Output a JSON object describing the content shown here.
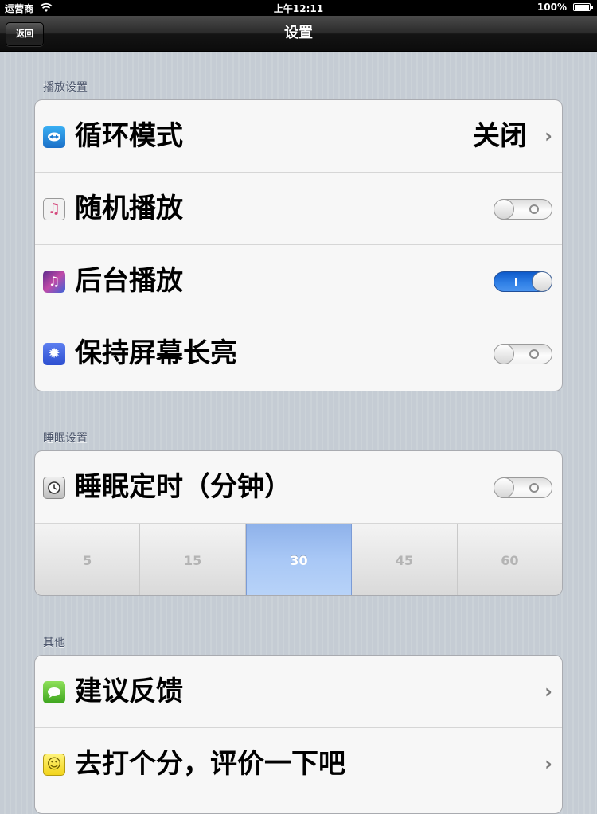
{
  "status_bar": {
    "carrier": "运营商",
    "time": "上午12:11",
    "battery": "100%"
  },
  "nav": {
    "back_label": "返回",
    "title": "设置"
  },
  "playback": {
    "header": "播放设置",
    "loop_mode": {
      "label": "循环模式",
      "value": "关闭",
      "icon": "loop-icon"
    },
    "shuffle": {
      "label": "随机播放",
      "on": false,
      "icon": "shuffle-music-icon"
    },
    "background_play": {
      "label": "后台播放",
      "on": true,
      "icon": "music-note-icon"
    },
    "keep_screen_on": {
      "label": "保持屏幕长亮",
      "on": false,
      "icon": "brightness-icon"
    }
  },
  "sleep": {
    "header": "睡眠设置",
    "timer": {
      "label": "睡眠定时（分钟）",
      "on": false,
      "icon": "clock-icon"
    },
    "options": [
      "5",
      "15",
      "30",
      "45",
      "60"
    ],
    "selected": "30"
  },
  "other": {
    "header": "其他",
    "feedback": {
      "label": "建议反馈",
      "icon": "message-icon"
    },
    "rate": {
      "label": "去打个分，评价一下吧",
      "icon": "smiley-icon"
    }
  },
  "colors": {
    "toggle_on": "#2f7fe6",
    "segment_selected": "#a9c8f6",
    "nav_bar": "#1a1a1a"
  }
}
